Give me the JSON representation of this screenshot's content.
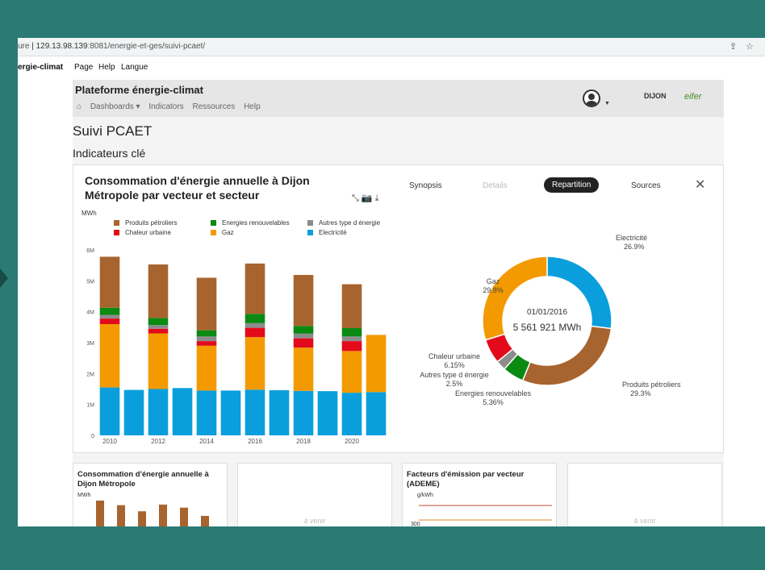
{
  "browser": {
    "url_prefix": "ure",
    "url_host": "129.13.98.139",
    "url_rest": ":8081/energie-et-ges/suivi-pcaet/"
  },
  "menubar": {
    "app": "ergie-climat",
    "items": [
      "Page",
      "Help",
      "Langue"
    ]
  },
  "header": {
    "title": "Plateforme énergie-climat",
    "nav": [
      "Dashboards ▾",
      "Indicators",
      "Ressources",
      "Help"
    ],
    "logo_dijon": "DIJON",
    "logo_eifer": "eifer"
  },
  "page": {
    "title": "Suivi PCAET",
    "subtitle": "Indicateurs clé"
  },
  "card": {
    "title": "Consommation d'énergie annuelle à Dijon Métropole par vecteur et secteur",
    "tabs": [
      "Synopsis",
      "Details",
      "Repartition",
      "Sources"
    ],
    "active_tab": "Repartition",
    "close": "✕"
  },
  "chart_data": [
    {
      "type": "bar",
      "stacked": true,
      "ylabel": "MWh",
      "ylim": [
        0,
        6000000
      ],
      "yticks": [
        "0",
        "1M",
        "2M",
        "3M",
        "4M",
        "5M",
        "6M"
      ],
      "xticks": [
        "2010",
        "2012",
        "2014",
        "2016",
        "2018",
        "2020"
      ],
      "categories": [
        "2010",
        "2011",
        "2012",
        "2013",
        "2014",
        "2015",
        "2016",
        "2017",
        "2018",
        "2019",
        "2020",
        "2021"
      ],
      "legend": [
        "Produits pétroliers",
        "Energies renouvelables",
        "Autres type d énergie",
        "Chaleur urbaine",
        "Gaz",
        "Electricité"
      ],
      "series": [
        {
          "name": "Electricité",
          "color": "#0a9fdc",
          "values": [
            1550000,
            1470000,
            1500000,
            1530000,
            1450000,
            1450000,
            1480000,
            1460000,
            1440000,
            1430000,
            1380000,
            1400000
          ]
        },
        {
          "name": "Gaz",
          "color": "#f39a00",
          "values": [
            2050000,
            0,
            1800000,
            0,
            1450000,
            0,
            1700000,
            0,
            1400000,
            0,
            1350000,
            1850000
          ]
        },
        {
          "name": "Chaleur urbaine",
          "color": "#e30b1b",
          "values": [
            180000,
            0,
            150000,
            0,
            150000,
            0,
            300000,
            0,
            300000,
            0,
            320000,
            0
          ]
        },
        {
          "name": "Autres type d énergie",
          "color": "#8c8c8c",
          "values": [
            120000,
            0,
            120000,
            0,
            150000,
            0,
            150000,
            0,
            150000,
            0,
            150000,
            0
          ]
        },
        {
          "name": "Energies renouvelables",
          "color": "#0a8a12",
          "values": [
            230000,
            0,
            230000,
            0,
            200000,
            0,
            300000,
            0,
            250000,
            0,
            270000,
            0
          ]
        },
        {
          "name": "Produits pétroliers",
          "color": "#a8642e",
          "values": [
            1650000,
            0,
            1730000,
            0,
            1700000,
            0,
            1630000,
            0,
            1650000,
            0,
            1420000,
            0
          ]
        }
      ]
    },
    {
      "type": "pie",
      "donut": true,
      "center_date": "01/01/2016",
      "center_value": "5 561 921 MWh",
      "slices": [
        {
          "label": "Electricité",
          "value": 26.9,
          "pct": "26.9%",
          "color": "#0a9fdc"
        },
        {
          "label": "Produits pétroliers",
          "value": 29.3,
          "pct": "29.3%",
          "color": "#a8642e"
        },
        {
          "label": "Energies renouvelables",
          "value": 5.36,
          "pct": "5.36%",
          "color": "#0a8a12"
        },
        {
          "label": "Autres type d énergie",
          "value": 2.5,
          "pct": "2.5%",
          "color": "#8c8c8c"
        },
        {
          "label": "Chaleur urbaine",
          "value": 6.15,
          "pct": "6.15%",
          "color": "#e30b1b"
        },
        {
          "label": "Gaz",
          "value": 29.8,
          "pct": "29.8%",
          "color": "#f39a00"
        }
      ]
    }
  ],
  "mini_cards": [
    {
      "title": "Consommation d'énergie annuelle à Dijon Métropole",
      "unit": "MWh",
      "venir": ""
    },
    {
      "title": "",
      "unit": "",
      "venir": "à venir"
    },
    {
      "title": "Facteurs d'émission par vecteur (ADEME)",
      "unit": "g/kWh",
      "venir": "",
      "tick": "300"
    },
    {
      "title": "",
      "unit": "",
      "venir": "à venir"
    }
  ],
  "mini_chart_values": [
    0.95,
    0.8,
    0.6,
    0.82,
    0.72,
    0.45
  ]
}
